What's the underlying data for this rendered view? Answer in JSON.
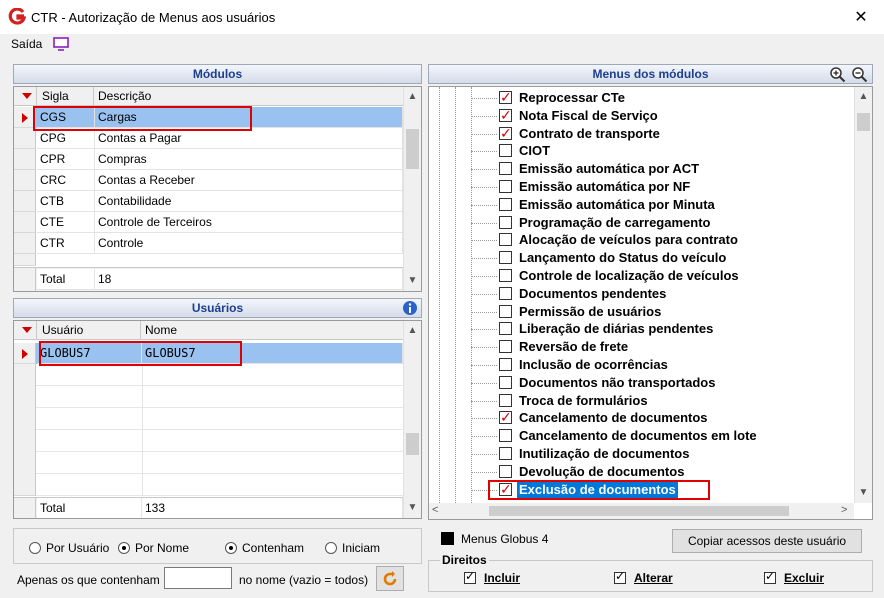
{
  "window": {
    "title": "CTR - Autorização de Menus aos usuários",
    "close_glyph": "✕"
  },
  "menu": {
    "saida": "Saída"
  },
  "modulos": {
    "header": "Módulos",
    "columns": {
      "sigla": "Sigla",
      "descricao": "Descrição"
    },
    "rows": [
      {
        "sigla": "CGS",
        "descricao": "Cargas"
      },
      {
        "sigla": "CPG",
        "descricao": "Contas a Pagar"
      },
      {
        "sigla": "CPR",
        "descricao": "Compras"
      },
      {
        "sigla": "CRC",
        "descricao": "Contas a Receber"
      },
      {
        "sigla": "CTB",
        "descricao": "Contabilidade"
      },
      {
        "sigla": "CTE",
        "descricao": "Controle de Terceiros"
      },
      {
        "sigla": "CTR",
        "descricao": "Controle"
      }
    ],
    "total_label": "Total",
    "total_value": "18"
  },
  "usuarios": {
    "header": "Usuários",
    "columns": {
      "usuario": "Usuário",
      "nome": "Nome"
    },
    "rows": [
      {
        "usuario": "GLOBUS7",
        "nome": "GLOBUS7"
      }
    ],
    "total_label": "Total",
    "total_value": "133"
  },
  "filters": {
    "por_usuario": "Por Usuário",
    "por_nome": "Por Nome",
    "contenham": "Contenham",
    "iniciam": "Iniciam",
    "apenas_label": "Apenas os que contenham",
    "apenas_value": "",
    "suffix": "no nome (vazio = todos)"
  },
  "menus": {
    "header": "Menus dos módulos",
    "items": [
      {
        "label": "Reprocessar CTe",
        "checked": true
      },
      {
        "label": "Nota Fiscal de Serviço",
        "checked": true
      },
      {
        "label": "Contrato de transporte",
        "checked": true
      },
      {
        "label": "CIOT",
        "checked": false
      },
      {
        "label": "Emissão automática por ACT",
        "checked": false
      },
      {
        "label": "Emissão automática por NF",
        "checked": false
      },
      {
        "label": "Emissão automática por Minuta",
        "checked": false
      },
      {
        "label": "Programação de carregamento",
        "checked": false
      },
      {
        "label": "Alocação de veículos para contrato",
        "checked": false
      },
      {
        "label": "Lançamento do Status do veículo",
        "checked": false
      },
      {
        "label": "Controle de localização de veículos",
        "checked": false
      },
      {
        "label": "Documentos pendentes",
        "checked": false
      },
      {
        "label": "Permissão de usuários",
        "checked": false
      },
      {
        "label": "Liberação de diárias pendentes",
        "checked": false
      },
      {
        "label": "Reversão de frete",
        "checked": false
      },
      {
        "label": "Inclusão de ocorrências",
        "checked": false
      },
      {
        "label": "Documentos não transportados",
        "checked": false
      },
      {
        "label": "Troca de formulários",
        "checked": false
      },
      {
        "label": "Cancelamento de documentos",
        "checked": true
      },
      {
        "label": "Cancelamento de documentos em lote",
        "checked": false
      },
      {
        "label": "Inutilização de documentos",
        "checked": false
      },
      {
        "label": "Devolução de documentos",
        "checked": false
      },
      {
        "label": "Exclusão de documentos",
        "checked": true
      }
    ]
  },
  "legend": {
    "label": "Menus Globus 4"
  },
  "copy_button": "Copiar acessos deste usuário",
  "direitos": {
    "label": "Direitos",
    "incluir": "Incluir",
    "alterar": "Alterar",
    "excluir": "Excluir"
  },
  "colors": {
    "selection": "#99c2f0",
    "highlight_box": "#e00000",
    "header_text": "#1c3f8f",
    "active_item": "#0078d7"
  },
  "icons": [
    "app-logo-icon",
    "monitor-icon",
    "close-icon",
    "zoom-in-icon",
    "zoom-out-icon",
    "info-icon",
    "refresh-icon",
    "row-indicator-icon"
  ]
}
